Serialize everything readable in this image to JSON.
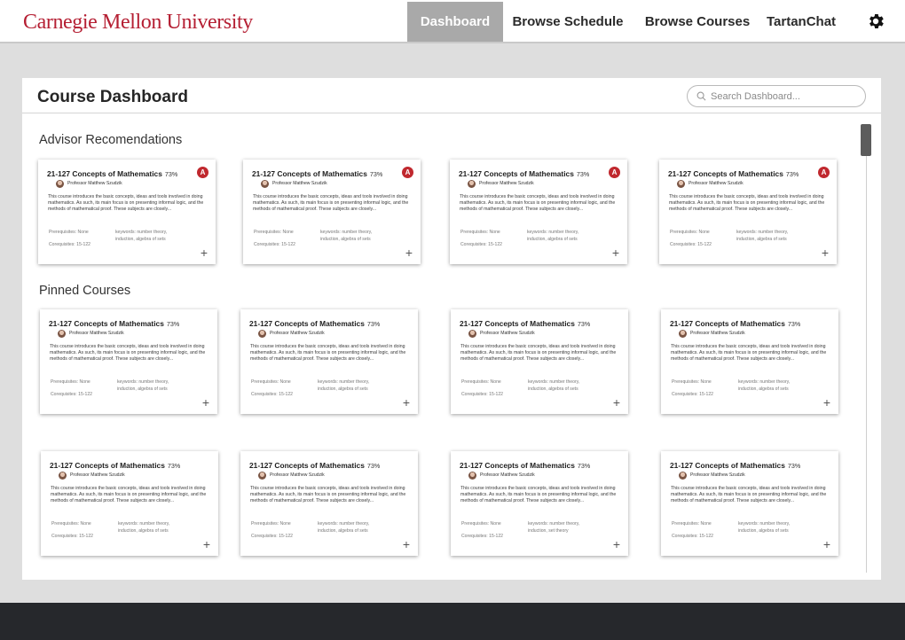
{
  "header": {
    "brand": "Carnegie Mellon University",
    "nav": [
      "Dashboard",
      "Browse Schedule",
      "Browse Courses",
      "TartanChat"
    ],
    "active_nav": "Dashboard",
    "settings_icon": "gear-icon"
  },
  "panel": {
    "title": "Course Dashboard",
    "search_placeholder": "Search Dashboard...",
    "search_value": ""
  },
  "sections": {
    "advisor": "Advisor Recomendations",
    "pinned": "Pinned Courses"
  },
  "colors": {
    "brand": "#b51f33",
    "badge": "#c0282e",
    "active_nav": "#a9a9a9",
    "footer": "#26282c"
  },
  "advisor_cards": [
    {
      "title": "21-127 Concepts of Mathematics",
      "pct": "73%",
      "badge": "A",
      "professor": "Professor Matthew Szudzik",
      "description": "This course introduces the basic concepts, ideas and tools involved in doing mathematics. As such, its main focus is on presenting informal logic, and the methods of mathematical proof. These subjects are closely...",
      "prereq": "Prerequisites: None",
      "coreq": "Corequisites: 15-122",
      "keywords": "keywords: number theory, induction, algebra of sets"
    },
    {
      "title": "21-127 Concepts of Mathematics",
      "pct": "73%",
      "badge": "A",
      "professor": "Professor Matthew Szudzik",
      "description": "This course introduces the basic concepts, ideas and tools involved in doing mathematics. As such, its main focus is on presenting informal logic, and the methods of mathematical proof. These subjects are closely...",
      "prereq": "Prerequisites: None",
      "coreq": "Corequisites: 15-122",
      "keywords": "keywords: number theory, induction, algebra of sets"
    },
    {
      "title": "21-127 Concepts of Mathematics",
      "pct": "73%",
      "badge": "A",
      "professor": "Professor Matthew Szudzik",
      "description": "This course introduces the basic concepts, ideas and tools involved in doing mathematics. As such, its main focus is on presenting informal logic, and the methods of mathematical proof. These subjects are closely...",
      "prereq": "Prerequisites: None",
      "coreq": "Corequisites: 15-122",
      "keywords": "keywords: number theory, induction, algebra of sets"
    },
    {
      "title": "21-127 Concepts of Mathematics",
      "pct": "73%",
      "badge": "A",
      "professor": "Professor Matthew Szudzik",
      "description": "This course introduces the basic concepts, ideas and tools involved in doing mathematics. As such, its main focus is on presenting informal logic, and the methods of mathematical proof. These subjects are closely...",
      "prereq": "Prerequisites: None",
      "coreq": "Corequisites: 15-122",
      "keywords": "keywords: number theory, induction, algebra of sets"
    }
  ],
  "pinned_cards": [
    {
      "title": "21-127 Concepts of Mathematics",
      "pct": "73%",
      "professor": "Professor Matthew Szudzik",
      "description": "This course introduces the basic concepts, ideas and tools involved in doing mathematics. As such, its main focus is on presenting informal logic, and the methods of mathematical proof. These subjects are closely...",
      "prereq": "Prerequisites: None",
      "coreq": "Corequisites: 15-122",
      "keywords": "keywords: number theory, induction, algebra of sets"
    },
    {
      "title": "21-127 Concepts of Mathematics",
      "pct": "73%",
      "professor": "Professor Matthew Szudzik",
      "description": "This course introduces the basic concepts, ideas and tools involved in doing mathematics. As such, its main focus is on presenting informal logic, and the methods of mathematical proof. These subjects are closely...",
      "prereq": "Prerequisites: None",
      "coreq": "Corequisites: 15-122",
      "keywords": "keywords: number theory, induction, algebra of sets"
    },
    {
      "title": "21-127 Concepts of Mathematics",
      "pct": "73%",
      "professor": "Professor Matthew Szudzik",
      "description": "This course introduces the basic concepts, ideas and tools involved in doing mathematics. As such, its main focus is on presenting informal logic, and the methods of mathematical proof. These subjects are closely...",
      "prereq": "Prerequisites: None",
      "coreq": "Corequisites: 15-122",
      "keywords": "keywords: number theory, induction, algebra of sets"
    },
    {
      "title": "21-127 Concepts of Mathematics",
      "pct": "73%",
      "professor": "Professor Matthew Szudzik",
      "description": "This course introduces the basic concepts, ideas and tools involved in doing mathematics. As such, its main focus is on presenting informal logic, and the methods of mathematical proof. These subjects are closely...",
      "prereq": "Prerequisites: None",
      "coreq": "Corequisites: 15-122",
      "keywords": "keywords: number theory, induction, algebra of sets"
    },
    {
      "title": "21-127 Concepts of Mathematics",
      "pct": "73%",
      "professor": "Professor Matthew Szudzik",
      "description": "This course introduces the basic concepts, ideas and tools involved in doing mathematics. As such, its main focus is on presenting informal logic, and the methods of mathematical proof. These subjects are closely...",
      "prereq": "Prerequisites: None",
      "coreq": "Corequisites: 15-122",
      "keywords": "keywords: number theory, induction, algebra of sets"
    },
    {
      "title": "21-127 Concepts of Mathematics",
      "pct": "73%",
      "professor": "Professor Matthew Szudzik",
      "description": "This course introduces the basic concepts, ideas and tools involved in doing mathematics. As such, its main focus is on presenting informal logic, and the methods of mathematical proof. These subjects are closely...",
      "prereq": "Prerequisites: None",
      "coreq": "Corequisites: 15-122",
      "keywords": "keywords: number theory, induction, algebra of sets"
    },
    {
      "title": "21-127 Concepts of Mathematics",
      "pct": "73%",
      "professor": "Professor Matthew Szudzik",
      "description": "This course introduces the basic concepts, ideas and tools involved in doing mathematics. As such, its main focus is on presenting informal logic, and the methods of mathematical proof. These subjects are closely...",
      "prereq": "Prerequisites: None",
      "coreq": "Corequisites: 15-122",
      "keywords": "keywords: number theory, induction, set theory"
    },
    {
      "title": "21-127 Concepts of Mathematics",
      "pct": "73%",
      "professor": "Professor Matthew Szudzik",
      "description": "This course introduces the basic concepts, ideas and tools involved in doing mathematics. As such, its main focus is on presenting informal logic, and the methods of mathematical proof. These subjects are closely...",
      "prereq": "Prerequisites: None",
      "coreq": "Corequisites: 15-122",
      "keywords": "keywords: number theory, induction, algebra of sets"
    }
  ]
}
